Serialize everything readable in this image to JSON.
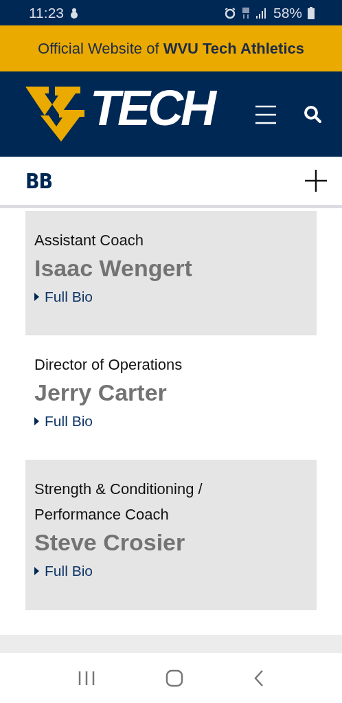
{
  "status_bar": {
    "time": "11:23",
    "battery": "58%"
  },
  "banner": {
    "text": "Official Website of **WVU Tech Athletics**"
  },
  "header": {
    "logo_text": "TECH"
  },
  "section": {
    "title": "BB",
    "expanded": false
  },
  "staff": [
    {
      "role": "Assistant Coach",
      "name": "Isaac Wengert",
      "link": "Full Bio"
    },
    {
      "role": "Director of Operations",
      "name": "Jerry Carter",
      "link": "Full Bio"
    },
    {
      "role": "Strength & Conditioning / Performance Coach",
      "name": "Steve Crosier",
      "link": "Full Bio"
    }
  ]
}
